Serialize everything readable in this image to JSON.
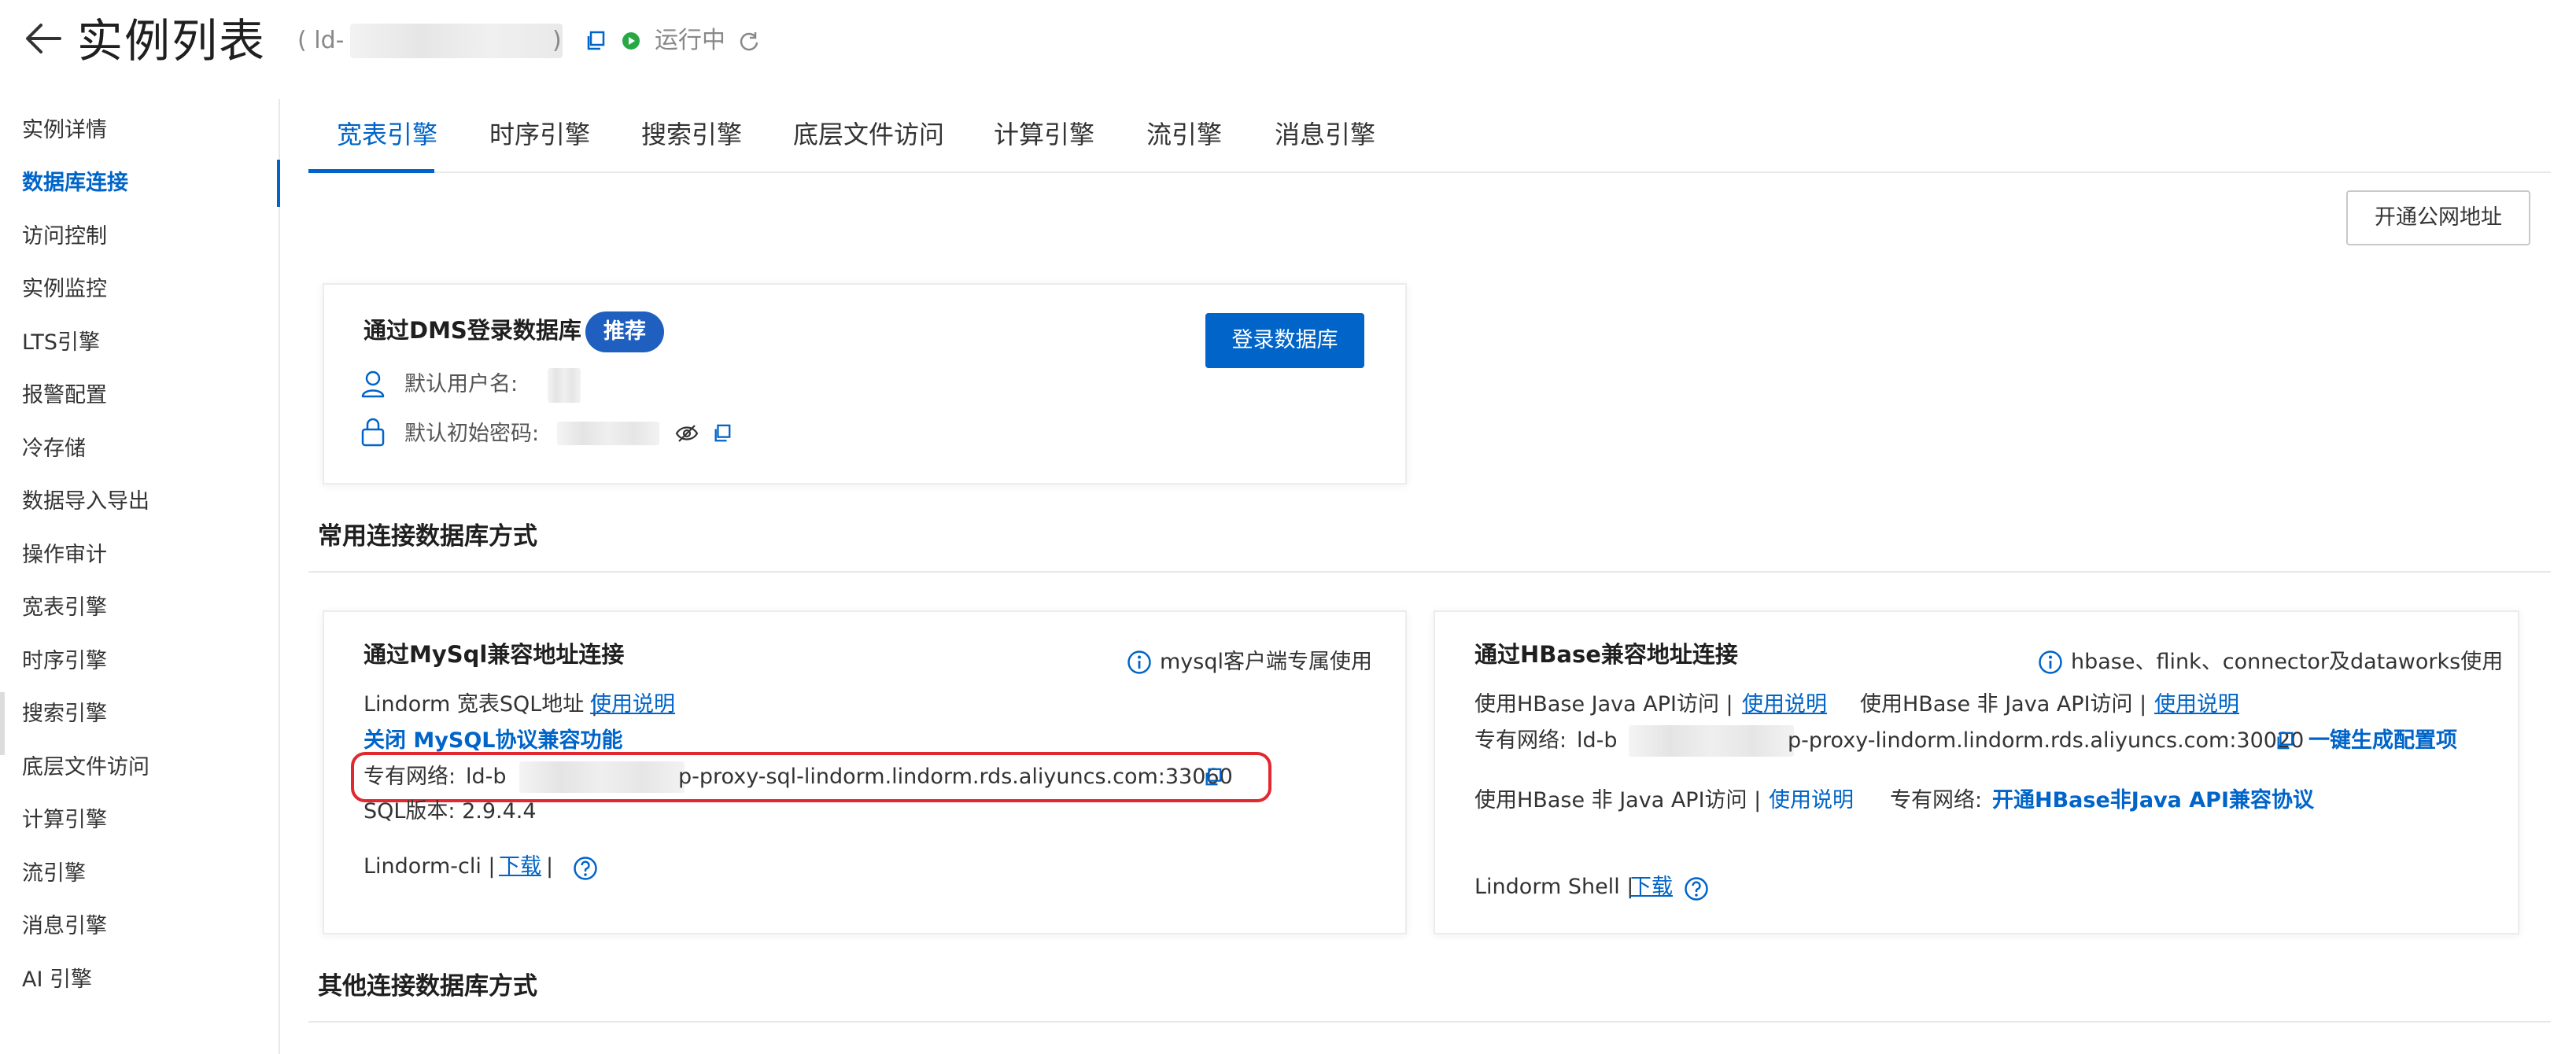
{
  "header": {
    "title": "实例列表",
    "instance_id_prefix": "( ld-",
    "instance_id_suffix": ")",
    "status": "运行中"
  },
  "sidebar": {
    "items": [
      {
        "label": "实例详情"
      },
      {
        "label": "数据库连接",
        "active": true
      },
      {
        "label": "访问控制"
      },
      {
        "label": "实例监控"
      },
      {
        "label": "LTS引擎"
      },
      {
        "label": "报警配置"
      },
      {
        "label": "冷存储"
      },
      {
        "label": "数据导入导出"
      },
      {
        "label": "操作审计"
      },
      {
        "label": "宽表引擎"
      },
      {
        "label": "时序引擎"
      },
      {
        "label": "搜索引擎"
      },
      {
        "label": "底层文件访问"
      },
      {
        "label": "计算引擎"
      },
      {
        "label": "流引擎"
      },
      {
        "label": "消息引擎"
      },
      {
        "label": "AI 引擎"
      }
    ]
  },
  "tabs": [
    {
      "label": "宽表引擎",
      "active": true
    },
    {
      "label": "时序引擎"
    },
    {
      "label": "搜索引擎"
    },
    {
      "label": "底层文件访问"
    },
    {
      "label": "计算引擎"
    },
    {
      "label": "流引擎"
    },
    {
      "label": "消息引擎"
    }
  ],
  "actions": {
    "public_address_button": "开通公网地址"
  },
  "dms_card": {
    "title": "通过DMS登录数据库",
    "badge": "推荐",
    "login_button": "登录数据库",
    "username_label": "默认用户名:",
    "password_label": "默认初始密码:"
  },
  "sections": {
    "common": "常用连接数据库方式",
    "other": "其他连接数据库方式"
  },
  "mysql_card": {
    "title": "通过MySql兼容地址连接",
    "hint": "mysql客户端专属使用",
    "sql_address_label": "Lindorm 宽表SQL地址 |",
    "usage_link": "使用说明",
    "close_link": "关闭 MySQL协议兼容功能",
    "vpc_label": "专有网络:",
    "vpc_prefix": "ld-b",
    "vpc_suffix": "p-proxy-sql-lindorm.lindorm.rds.aliyuncs.com:33060",
    "sql_version": "SQL版本:  2.9.4.4",
    "cli_label": "Lindorm-cli |",
    "download_link": "下载",
    "cli_sep": "|"
  },
  "hbase_card": {
    "title": "通过HBase兼容地址连接",
    "hint": "hbase、flink、connector及dataworks使用",
    "java_api_label": "使用HBase Java API访问  |",
    "java_usage_link": "使用说明",
    "non_java_label": "使用HBase 非 Java API访问  |",
    "non_java_usage_link": "使用说明",
    "vpc_label": "专有网络:",
    "vpc_prefix": "ld-b",
    "vpc_suffix": "p-proxy-lindorm.lindorm.rds.aliyuncs.com:30020",
    "gen_config_link": "一键生成配置项",
    "non_java_label2": "使用HBase 非 Java API访问  |",
    "non_java_usage_link2": "使用说明",
    "vpc_label2": "专有网络:",
    "enable_link": "开通HBase非Java API兼容协议",
    "shell_label": "Lindorm Shell |",
    "download_link": "下载"
  },
  "colors": {
    "primary": "#0064c8",
    "badge": "#1e5fbf",
    "status_green": "#27a844",
    "highlight_red": "#e0282e"
  }
}
